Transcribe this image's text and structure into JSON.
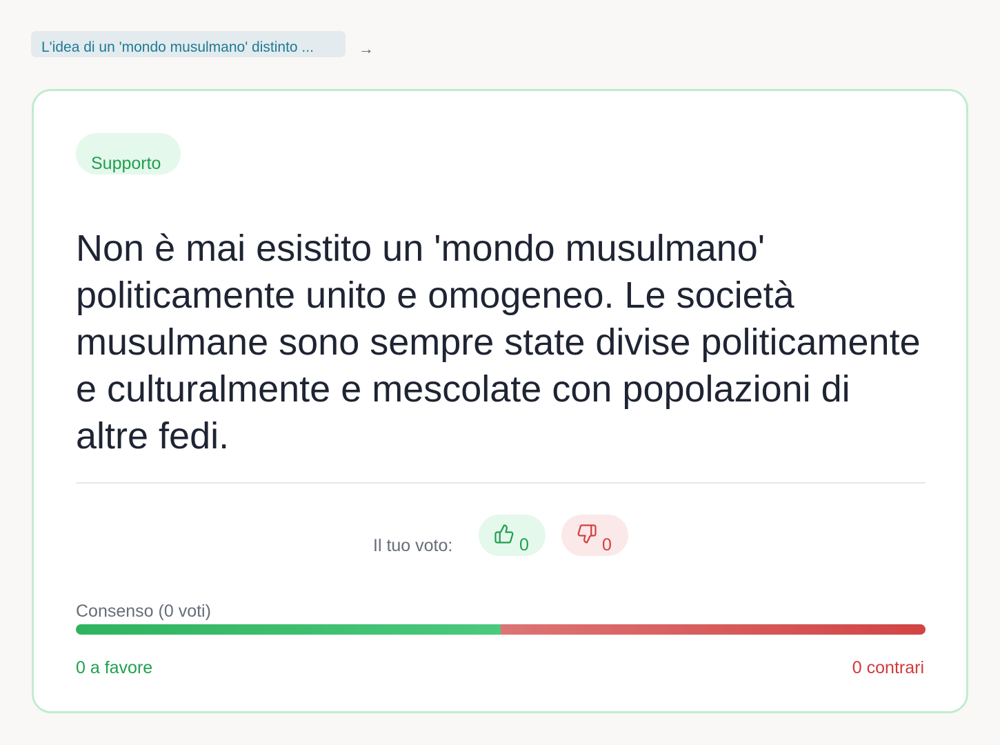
{
  "breadcrumb": {
    "parent_text": "L'idea di un 'mondo musulmano' distinto ...",
    "arrow": "→"
  },
  "argument": {
    "badge": "Supporto",
    "text": "Non è mai esistito un 'mondo musulmano' politicamente unito e omogeneo. Le società musulmane sono sempre state divise politicamente e culturalmente e mescolate con popolazioni di altre fedi."
  },
  "voting": {
    "label": "Il tuo voto:",
    "up_count": "0",
    "down_count": "0",
    "up_icon": "thumbs-up-icon",
    "down_icon": "thumbs-down-icon"
  },
  "consensus": {
    "label": "Consenso (0 voti)",
    "for_fraction": 0.5,
    "for_text": "0 a favore",
    "against_text": "0 contrari"
  },
  "colors": {
    "support": "#1fa04f",
    "oppose": "#d24040",
    "card_border": "#bfeccd",
    "link": "#1f7a94"
  }
}
